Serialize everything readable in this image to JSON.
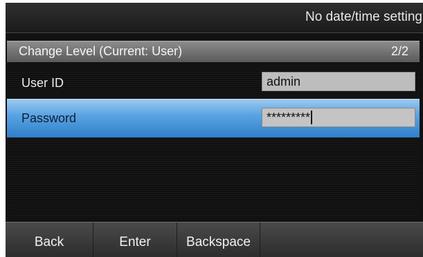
{
  "status_bar": {
    "text": "No date/time setting"
  },
  "title_bar": {
    "title": "Change Level (Current: User)",
    "page": "2/2"
  },
  "form": {
    "user_id": {
      "label": "User ID",
      "value": "admin"
    },
    "password": {
      "label": "Password",
      "value": "*********",
      "selected": true
    }
  },
  "softkeys": {
    "back": "Back",
    "enter": "Enter",
    "backspace": "Backspace"
  },
  "colors": {
    "selected_row": "#5aa4e2",
    "field_background": "#bdbdbd",
    "screen_background": "#121212"
  }
}
